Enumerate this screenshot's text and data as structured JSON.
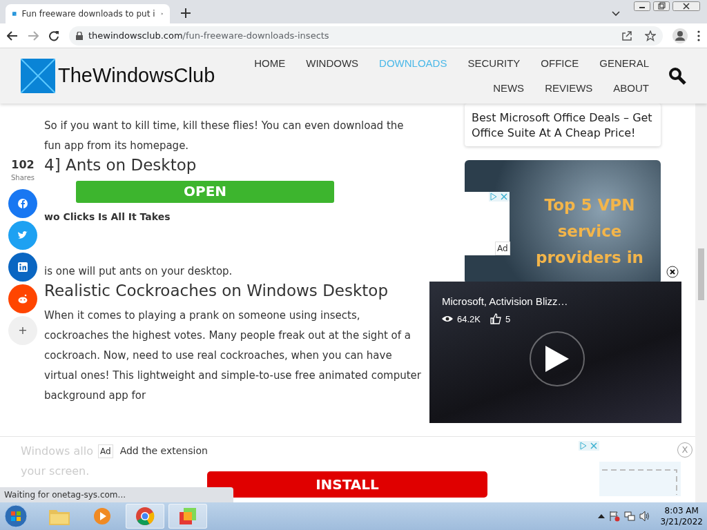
{
  "browser": {
    "tab_title": "Fun freeware downloads to put i",
    "url_domain": "thewindowsclub.com",
    "url_path": "/fun-freeware-downloads-insects",
    "status": "Waiting for onetag-sys.com..."
  },
  "site": {
    "logo": "TheWindowsClub",
    "nav": [
      {
        "label": "HOME",
        "selected": false
      },
      {
        "label": "WINDOWS",
        "selected": false
      },
      {
        "label": "DOWNLOADS",
        "selected": true
      },
      {
        "label": "SECURITY",
        "selected": false
      },
      {
        "label": "OFFICE",
        "selected": false
      },
      {
        "label": "GENERAL",
        "selected": false
      },
      {
        "label": "NEWS",
        "selected": false
      },
      {
        "label": "REVIEWS",
        "selected": false
      },
      {
        "label": "ABOUT",
        "selected": false
      }
    ]
  },
  "article": {
    "blocks": [
      {
        "kind": "paragraph",
        "text": "So if you want to kill time, kill these flies! You can even download the fun app from its homepage."
      },
      {
        "kind": "heading",
        "text": "4] Ants on Desktop"
      },
      {
        "kind": "ad_button",
        "text": "OPEN"
      },
      {
        "kind": "ad_caption",
        "text": "wo Clicks Is All It Takes"
      },
      {
        "kind": "paragraph",
        "text": "is one will put ants on your desktop."
      },
      {
        "kind": "heading",
        "text": "Realistic Cockroaches on Windows Desktop"
      },
      {
        "kind": "paragraph",
        "text": "When it comes to playing a prank on someone using insects, cockroaches the highest votes. Many people freak out at the sight of a cockroach. Now, need to use real cockroaches, when you can have virtual ones! This lightweight and simple-to-use free animated computer background app for"
      }
    ]
  },
  "share": {
    "count": "102",
    "label": "Shares",
    "buttons": [
      {
        "kind": "facebook"
      },
      {
        "kind": "twitter"
      },
      {
        "kind": "linkedin"
      },
      {
        "kind": "reddit"
      },
      {
        "kind": "more",
        "text": "+"
      }
    ]
  },
  "sidebar": {
    "card_title": "Best Microsoft Office Deals – Get Office Suite At A Cheap Price!",
    "ad_text": "Top 5 VPN service providers in",
    "ad_label": "Ad"
  },
  "video": {
    "title": "Microsoft, Activision Blizz…",
    "views": "64.2K",
    "likes": "5"
  },
  "bottom_ad": {
    "faded_text": [
      "Windows allo",
      "your screen."
    ],
    "label": "Ad",
    "text": "Add the extension",
    "button": "INSTALL",
    "close": "X"
  },
  "taskbar": {
    "time": "8:03 AM",
    "date": "3/21/2022"
  }
}
